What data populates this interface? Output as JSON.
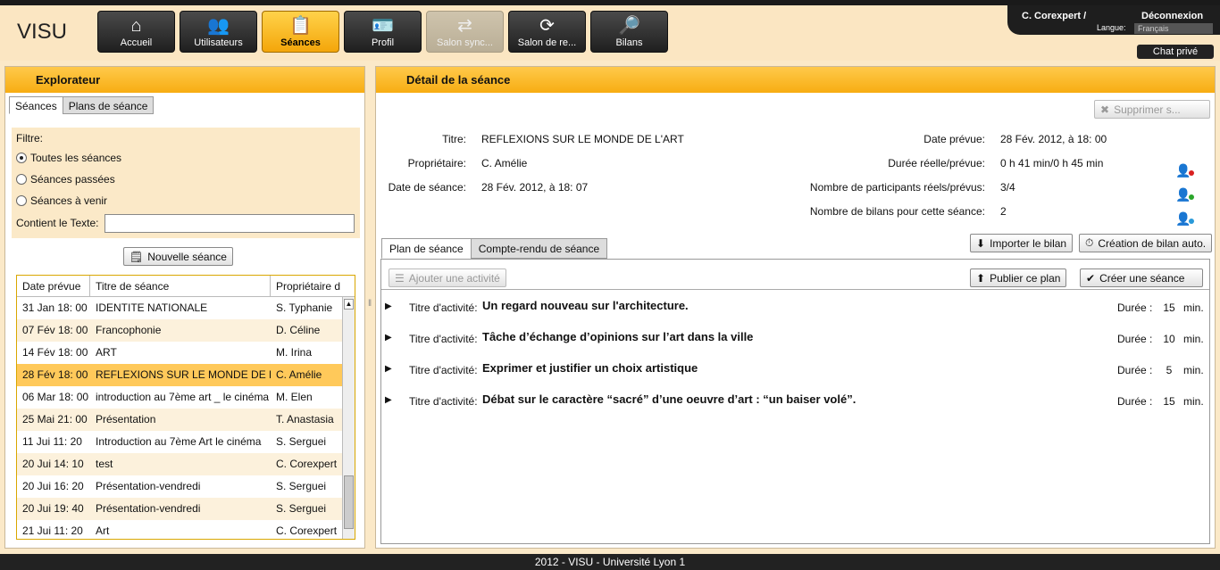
{
  "app": {
    "title": "VISU"
  },
  "nav": [
    {
      "label": "Accueil",
      "icon": "home-icon",
      "glyph": "⌂"
    },
    {
      "label": "Utilisateurs",
      "icon": "users-icon",
      "glyph": "👥"
    },
    {
      "label": "Séances",
      "icon": "clipboard-icon",
      "glyph": "📋"
    },
    {
      "label": "Profil",
      "icon": "profile-card-icon",
      "glyph": "🪪"
    },
    {
      "label": "Salon sync...",
      "icon": "sync-room-icon",
      "glyph": "⇄"
    },
    {
      "label": "Salon de re...",
      "icon": "refresh-icon",
      "glyph": "⟳"
    },
    {
      "label": "Bilans",
      "icon": "search-report-icon",
      "glyph": "🔎"
    }
  ],
  "user": {
    "name": "C. Corexpert  /",
    "logout": "Déconnexion",
    "lang_label": "Langue:",
    "lang_value": "Français",
    "chat": "Chat privé"
  },
  "explorer": {
    "title": "Explorateur",
    "tabs": [
      "Séances",
      "Plans de séance"
    ],
    "filter_label": "Filtre:",
    "radios": [
      "Toutes les séances",
      "Séances passées",
      "Séances à venir"
    ],
    "contains_label": "Contient le Texte:",
    "new_button": "Nouvelle séance",
    "columns": [
      "Date prévue",
      "Titre de séance",
      "Propriétaire d"
    ],
    "rows": [
      [
        "31 Jan 18: 00",
        "IDENTITE NATIONALE",
        "S. Typhanie"
      ],
      [
        "07 Fév 18: 00",
        "Francophonie",
        "D. Céline"
      ],
      [
        "14 Fév 18: 00",
        "ART",
        "M. Irina"
      ],
      [
        "28 Fév 18: 00",
        "REFLEXIONS SUR LE MONDE DE L'ART",
        "C. Amélie"
      ],
      [
        "06 Mar 18: 00",
        "introduction au 7ème art _ le cinéma",
        "M. Elen"
      ],
      [
        "25 Mai 21: 00",
        "Présentation",
        "T. Anastasia"
      ],
      [
        "11 Jui 11: 20",
        "Introduction au 7ème Art  le cinéma",
        "S. Serguei"
      ],
      [
        "20 Jui 14: 10",
        "test",
        "C. Corexpert"
      ],
      [
        "20 Jui 16: 20",
        "Présentation-vendredi",
        "S. Serguei"
      ],
      [
        "20 Jui 19: 40",
        "Présentation-vendredi",
        "S. Serguei"
      ],
      [
        "21 Jui 11: 20",
        "Art",
        "C. Corexpert"
      ]
    ]
  },
  "detail": {
    "title": "Détail de la séance",
    "delete_button": "Supprimer s...",
    "fields_left": [
      {
        "label": "Titre:",
        "value": "REFLEXIONS SUR LE MONDE DE L'ART"
      },
      {
        "label": "Propriétaire:",
        "value": "C. Amélie"
      },
      {
        "label": "Date de séance:",
        "value": "28 Fév. 2012, à 18: 07"
      }
    ],
    "fields_right": [
      {
        "label": "Date prévue:",
        "value": "28 Fév. 2012, à 18: 00"
      },
      {
        "label": "Durée réelle/prévue:",
        "value": "0 h 41 min/0 h 45 min"
      },
      {
        "label": "Nombre de participants réels/prévus:",
        "value": "3/4"
      },
      {
        "label": "Nombre de bilans pour cette séance:",
        "value": "2"
      }
    ],
    "status_dot_colors": [
      "#d92020",
      "#2aa52a",
      "#2a9ad9",
      "#e0c000"
    ],
    "import_button": "Importer le bilan",
    "auto_button": "Création de bilan auto.",
    "tabs": [
      "Plan de séance",
      "Compte-rendu de séance"
    ],
    "add_activity": "Ajouter une activité",
    "publish": "Publier ce plan",
    "create": "Créer une séance",
    "activity_label": "Titre d'activité:",
    "duration_label": "Durée :",
    "unit": "min.",
    "activities": [
      {
        "title": "Un regard nouveau sur l'architecture.",
        "duration": "15"
      },
      {
        "title": "Tâche d’échange d’opinions sur l’art dans la ville",
        "duration": "10"
      },
      {
        "title": "Exprimer et justifier un choix artistique",
        "duration": "5"
      },
      {
        "title": "Débat sur le caractère “sacré” d’une oeuvre d’art : “un baiser volé”.",
        "duration": "15"
      }
    ]
  },
  "footer": "2012 - VISU - Université Lyon 1"
}
